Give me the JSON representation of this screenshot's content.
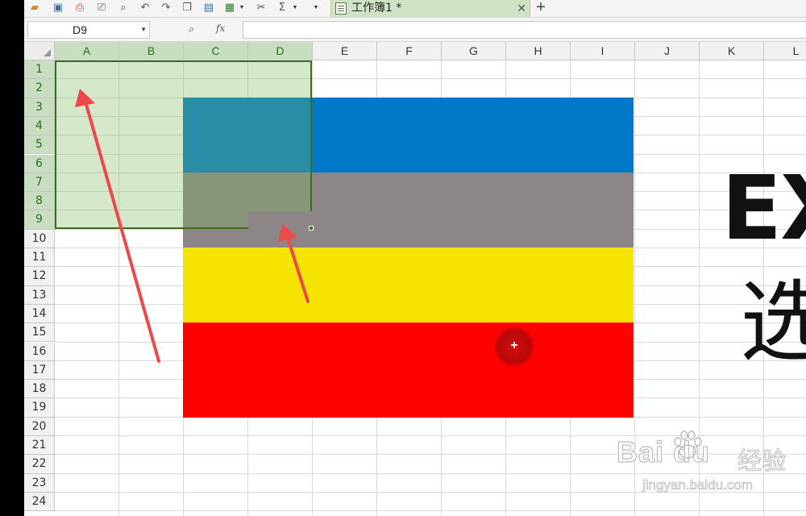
{
  "window": {
    "tab_title": "工作簿1 *",
    "close_symbol": "✕",
    "new_tab_symbol": "+"
  },
  "toolbar": {
    "icons": [
      "open-folder-icon",
      "save-icon",
      "export-pdf-icon",
      "print-icon",
      "print-preview-icon",
      "undo-icon",
      "redo-icon",
      "copy-icon",
      "paste-icon",
      "fill-icon",
      "cut-icon",
      "sum-icon",
      "more-icon"
    ]
  },
  "formula_bar": {
    "name_box": "D9",
    "fx_label": "fx",
    "formula": ""
  },
  "sheet": {
    "columns": [
      "A",
      "B",
      "C",
      "D",
      "E",
      "F",
      "G",
      "H",
      "I",
      "J",
      "K",
      "L"
    ],
    "selected_columns": [
      "A",
      "B",
      "C",
      "D"
    ],
    "rows": [
      "1",
      "2",
      "3",
      "4",
      "5",
      "6",
      "7",
      "8",
      "9",
      "10",
      "11",
      "12",
      "13",
      "14",
      "15",
      "16",
      "17",
      "18",
      "19",
      "20",
      "21",
      "22",
      "23",
      "24"
    ],
    "selected_rows": [
      "1",
      "2",
      "3",
      "4",
      "5",
      "6",
      "7",
      "8",
      "9"
    ],
    "selection_range": "A1:D9",
    "active_cell": "D9"
  },
  "image": {
    "bands": [
      {
        "name": "blue",
        "color": "#0079c9"
      },
      {
        "name": "gray",
        "color": "#8c8687"
      },
      {
        "name": "yellow",
        "color": "#f5e401"
      },
      {
        "name": "red",
        "color": "#fe0100"
      }
    ]
  },
  "overlay": {
    "big_text_1": "EX",
    "big_text_2": "选",
    "arrow_color": "#f0484a",
    "cursor_symbol": "+",
    "watermark_logo": "Bai du",
    "watermark_logo_2": "经验",
    "watermark_url": "jingyan.baidu.com"
  }
}
